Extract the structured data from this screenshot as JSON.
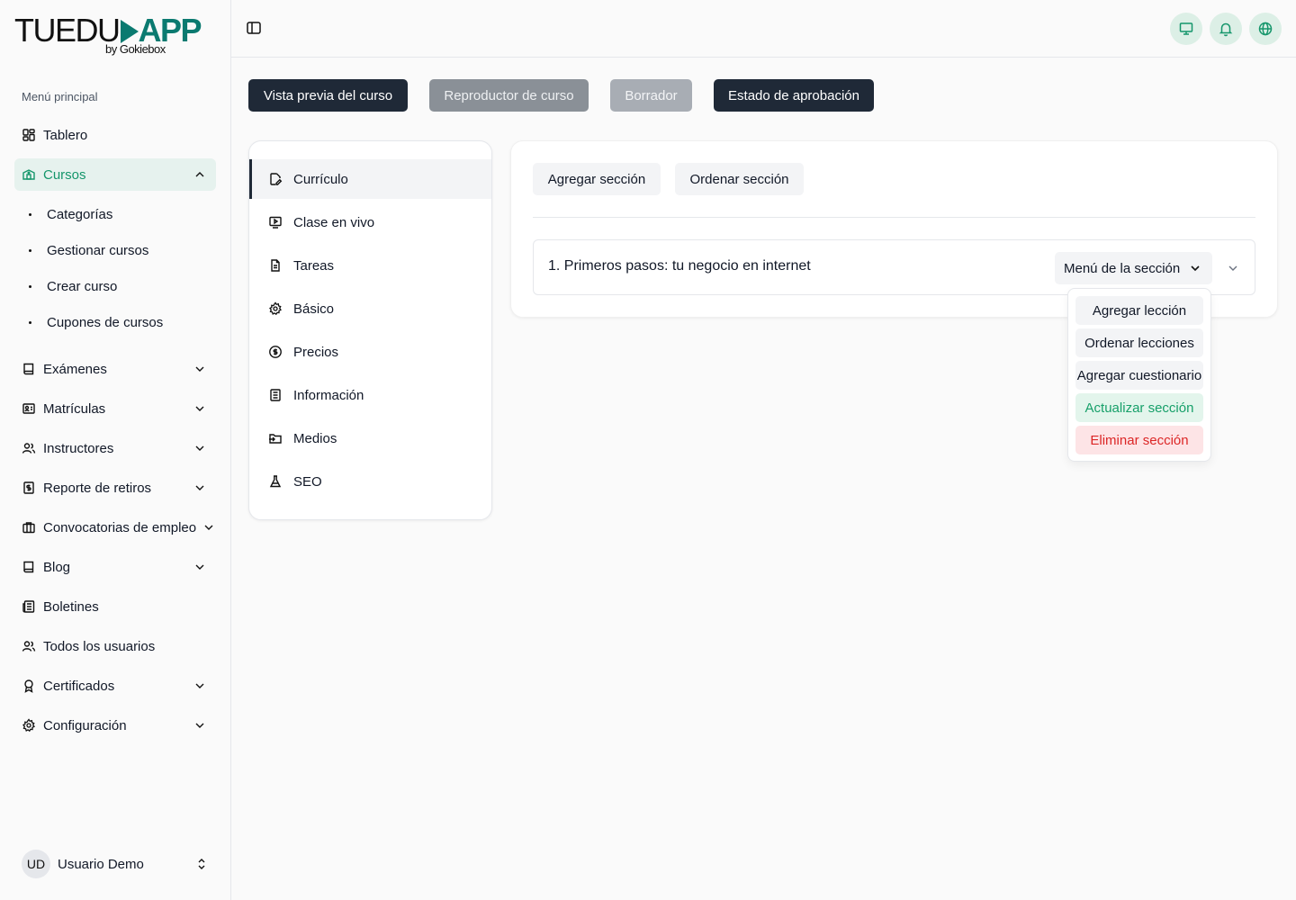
{
  "brand": {
    "name_main": "TUEDU",
    "name_accent": "APP",
    "byline": "by Gokiebox",
    "accent_color": "#0b7a70"
  },
  "sidebar": {
    "caption": "Menú principal",
    "items": [
      {
        "label": "Tablero",
        "icon": "dashboard-icon"
      },
      {
        "label": "Cursos",
        "icon": "courses-icon",
        "expanded": true
      },
      {
        "label": "Exámenes",
        "icon": "book-icon"
      },
      {
        "label": "Matrículas",
        "icon": "enrollment-icon"
      },
      {
        "label": "Instructores",
        "icon": "users-icon"
      },
      {
        "label": "Reporte de retiros",
        "icon": "dollar-report-icon"
      },
      {
        "label": "Convocatorias de empleo",
        "icon": "briefcase-icon"
      },
      {
        "label": "Blog",
        "icon": "book-icon"
      },
      {
        "label": "Boletines",
        "icon": "newspaper-icon"
      },
      {
        "label": "Todos los usuarios",
        "icon": "users-icon"
      },
      {
        "label": "Certificados",
        "icon": "award-icon"
      },
      {
        "label": "Configuración",
        "icon": "gear-icon"
      }
    ],
    "course_subitems": [
      "Categorías",
      "Gestionar cursos",
      "Crear curso",
      "Cupones de cursos"
    ]
  },
  "user": {
    "initials": "UD",
    "name": "Usuario Demo"
  },
  "actions": {
    "preview": "Vista previa del curso",
    "player": "Reproductor de curso",
    "draft": "Borrador",
    "approval": "Estado de aprobación"
  },
  "tabs": [
    {
      "label": "Currículo",
      "icon": "edit-document-icon",
      "active": true
    },
    {
      "label": "Clase en vivo",
      "icon": "live-class-icon"
    },
    {
      "label": "Tareas",
      "icon": "document-icon"
    },
    {
      "label": "Básico",
      "icon": "gear-icon"
    },
    {
      "label": "Precios",
      "icon": "dollar-icon"
    },
    {
      "label": "Información",
      "icon": "info-document-icon"
    },
    {
      "label": "Medios",
      "icon": "media-folder-icon"
    },
    {
      "label": "SEO",
      "icon": "flask-icon"
    }
  ],
  "curriculum": {
    "add_section": "Agregar sección",
    "sort_section": "Ordenar sección",
    "sections": [
      {
        "title": "1. Primeros pasos: tu negocio en internet",
        "menu_label": "Menú de la sección"
      }
    ]
  },
  "section_menu": {
    "items": [
      {
        "label": "Agregar lección",
        "variant": "default"
      },
      {
        "label": "Ordenar lecciones",
        "variant": "default"
      },
      {
        "label": "Agregar cuestionario",
        "variant": "default"
      },
      {
        "label": "Actualizar sección",
        "variant": "success"
      },
      {
        "label": "Eliminar sección",
        "variant": "danger"
      }
    ]
  },
  "colors": {
    "success": "#17a06a",
    "danger": "#dc2626",
    "dark_button": "#1f2937",
    "active_nav_bg": "#e6f2ee"
  }
}
